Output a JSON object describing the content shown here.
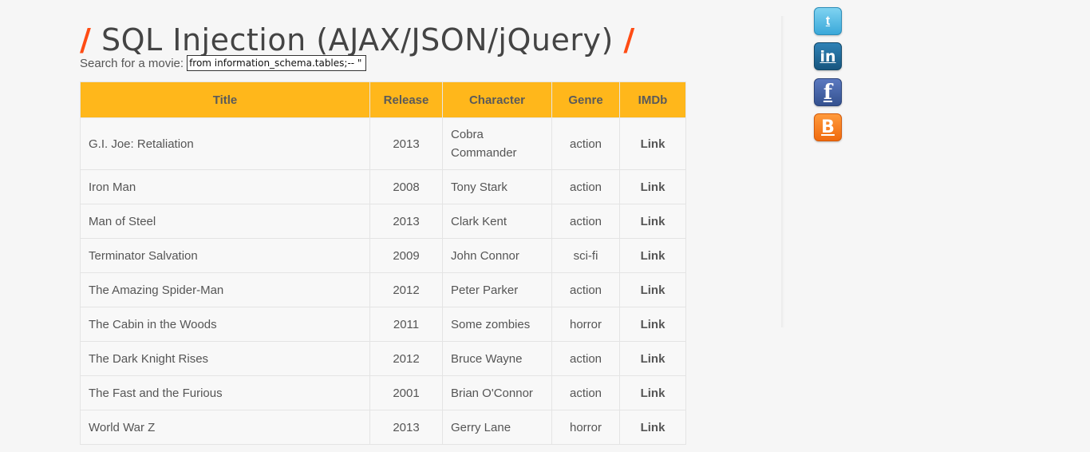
{
  "header": {
    "slash_left": "/",
    "title": "SQL Injection (AJAX/JSON/jQuery)",
    "slash_right": "/"
  },
  "search": {
    "label": "Search for a movie:",
    "value": "from information_schema.tables;-- \""
  },
  "table": {
    "columns": [
      "Title",
      "Release",
      "Character",
      "Genre",
      "IMDb"
    ],
    "rows": [
      {
        "title": "G.I. Joe: Retaliation",
        "release": "2013",
        "character": "Cobra Commander",
        "genre": "action",
        "imdb": "Link"
      },
      {
        "title": "Iron Man",
        "release": "2008",
        "character": "Tony Stark",
        "genre": "action",
        "imdb": "Link"
      },
      {
        "title": "Man of Steel",
        "release": "2013",
        "character": "Clark Kent",
        "genre": "action",
        "imdb": "Link"
      },
      {
        "title": "Terminator Salvation",
        "release": "2009",
        "character": "John Connor",
        "genre": "sci-fi",
        "imdb": "Link"
      },
      {
        "title": "The Amazing Spider-Man",
        "release": "2012",
        "character": "Peter Parker",
        "genre": "action",
        "imdb": "Link"
      },
      {
        "title": "The Cabin in the Woods",
        "release": "2011",
        "character": "Some zombies",
        "genre": "horror",
        "imdb": "Link"
      },
      {
        "title": "The Dark Knight Rises",
        "release": "2012",
        "character": "Bruce Wayne",
        "genre": "action",
        "imdb": "Link"
      },
      {
        "title": "The Fast and the Furious",
        "release": "2001",
        "character": "Brian O'Connor",
        "genre": "action",
        "imdb": "Link"
      },
      {
        "title": "World War Z",
        "release": "2013",
        "character": "Gerry Lane",
        "genre": "horror",
        "imdb": "Link"
      }
    ]
  },
  "social": [
    {
      "name": "twitter-icon",
      "glyph": "t"
    },
    {
      "name": "linkedin-icon",
      "glyph": "in"
    },
    {
      "name": "facebook-icon",
      "glyph": "f"
    },
    {
      "name": "blogger-icon",
      "glyph": "B"
    }
  ],
  "colors": {
    "accent": "#ff4c14",
    "table_header": "#ffb71b"
  }
}
